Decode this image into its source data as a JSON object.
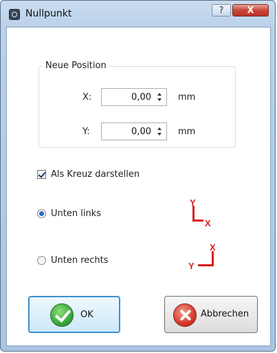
{
  "window": {
    "title": "Nullpunkt",
    "help_label": "?",
    "close_label": "X"
  },
  "group": {
    "legend": "Neue Position",
    "x": {
      "label": "X:",
      "value": "0,00",
      "unit": "mm"
    },
    "y": {
      "label": "Y:",
      "value": "0,00",
      "unit": "mm"
    }
  },
  "options": {
    "cross_label": "Als Kreuz darstellen",
    "cross_checked": true,
    "unten_links_label": "Unten links",
    "unten_rechts_label": "Unten rechts",
    "selected": "Unten links"
  },
  "axes": {
    "y": "Y",
    "x": "X",
    "color": "#d81e1e"
  },
  "buttons": {
    "ok_label": "OK",
    "cancel_label": "Abbrechen"
  },
  "icons": {
    "app": "app-icon",
    "ok": "check-icon",
    "cancel": "cancel-x-icon"
  }
}
